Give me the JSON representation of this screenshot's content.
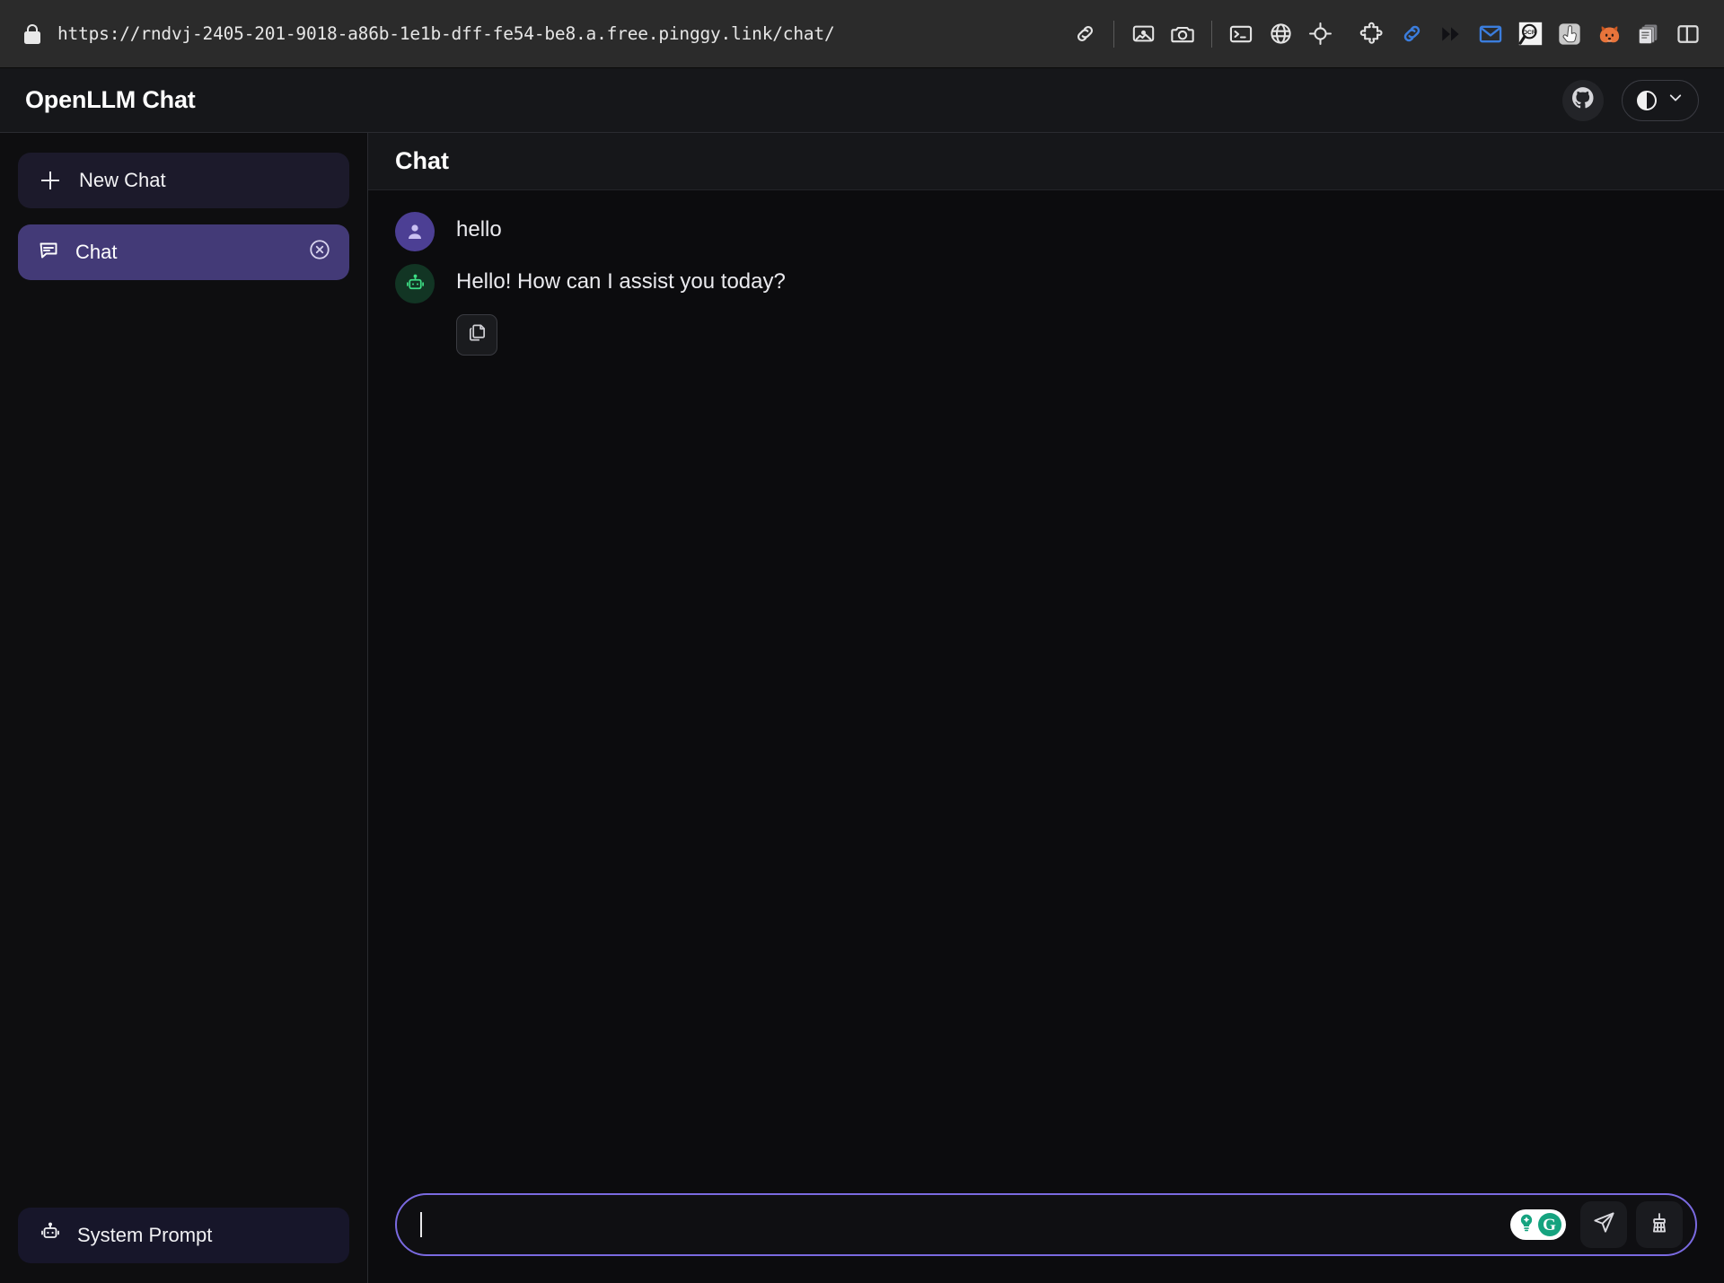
{
  "browser": {
    "lock_icon": "lock-icon",
    "url": "https://rndvj-2405-201-9018-a86b-1e1b-dff-fe54-be8.a.free.pinggy.link/chat/",
    "toolbar_icons": [
      "link-icon",
      "separator",
      "image-icon",
      "camera-icon",
      "separator",
      "terminal-icon",
      "globe-icon",
      "target-icon",
      "gap",
      "puzzle-icon",
      "blue-link-icon",
      "fast-forward-icon",
      "mail-icon",
      "ocr-search-icon",
      "touch-pointer-icon",
      "firefox-fox-icon",
      "document-stack-icon",
      "sidebar-toggle-icon"
    ]
  },
  "app": {
    "title": "OpenLLM Chat",
    "github_icon": "github-icon",
    "theme_toggle": {
      "icon": "contrast-icon",
      "chevron": "chevron-down-icon"
    }
  },
  "sidebar": {
    "new_chat": {
      "label": "New Chat",
      "icon": "plus-icon"
    },
    "conversations": [
      {
        "label": "Chat",
        "icon": "chat-bubble-icon",
        "close_icon": "close-circle-icon",
        "active": true
      }
    ],
    "system_prompt": {
      "label": "System Prompt",
      "icon": "robot-icon"
    }
  },
  "main": {
    "header_title": "Chat",
    "messages": [
      {
        "role": "user",
        "avatar_icon": "user-avatar-icon",
        "text": "hello"
      },
      {
        "role": "assistant",
        "avatar_icon": "robot-avatar-icon",
        "text": "Hello! How can I assist you today?",
        "actions": [
          {
            "name": "copy-button",
            "icon": "copy-icon"
          }
        ]
      }
    ],
    "composer": {
      "value": "",
      "placeholder": "",
      "grammarly_badge": {
        "lightbulb_icon": "lightbulb-icon",
        "letter": "G"
      },
      "send_button": {
        "icon": "send-plane-icon"
      },
      "clear_button": {
        "icon": "broom-icon"
      }
    }
  },
  "colors": {
    "accent_purple": "#7a6ae0",
    "active_item": "#433a77",
    "user_avatar": "#4c3f94",
    "bot_avatar": "#123524",
    "bot_icon_green": "#3ddc84",
    "grammarly_green": "#15a37f",
    "page_bg": "#0c0c0e",
    "sidebar_bg": "#0e0e10",
    "header_bg": "#16171a",
    "browser_bar_bg": "#2b2b2b"
  }
}
